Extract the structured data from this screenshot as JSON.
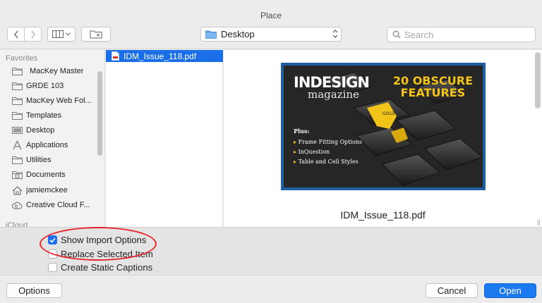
{
  "window": {
    "title": "Place"
  },
  "toolbar": {
    "location": "Desktop",
    "search_placeholder": "Search"
  },
  "sidebar": {
    "favorites_label": "Favorites",
    "items": [
      {
        "label": "MacKey Master",
        "icon": "folder-icon"
      },
      {
        "label": "GRDE 103",
        "icon": "folder-icon"
      },
      {
        "label": "MacKey Web Fol...",
        "icon": "folder-icon"
      },
      {
        "label": "Templates",
        "icon": "folder-icon"
      },
      {
        "label": "Desktop",
        "icon": "desktop-icon"
      },
      {
        "label": "Applications",
        "icon": "applications-icon"
      },
      {
        "label": "Utilities",
        "icon": "folder-icon"
      },
      {
        "label": "Documents",
        "icon": "documents-icon"
      },
      {
        "label": "jamiemckee",
        "icon": "home-icon"
      },
      {
        "label": "Creative Cloud F...",
        "icon": "creative-cloud-icon"
      }
    ],
    "icloud_label": "iCloud"
  },
  "files": [
    {
      "name": "IDM_Issue_118.pdf",
      "selected": true
    }
  ],
  "preview": {
    "filename": "IDM_Issue_118.pdf",
    "cover": {
      "brand_line1": "INDESIGN",
      "brand_line2": "magazine",
      "headline_line1": "20 OBSCURE",
      "headline_line2": "FEATURES",
      "plus_label": "Plus:",
      "bullets": [
        "Frame Fitting Options",
        "InQuestion",
        "Table and Cell Styles"
      ]
    }
  },
  "import_options": [
    {
      "label": "Show Import Options",
      "checked": true
    },
    {
      "label": "Replace Selected Item",
      "checked": false
    },
    {
      "label": "Create Static Captions",
      "checked": false
    }
  ],
  "footer": {
    "options_label": "Options",
    "cancel_label": "Cancel",
    "open_label": "Open"
  },
  "colors": {
    "accent": "#1c7af0",
    "selection": "#1a6fe8",
    "highlight_oval": "#e6262a",
    "cover_yellow": "#f2c318",
    "cover_border": "#1f5fa0"
  }
}
